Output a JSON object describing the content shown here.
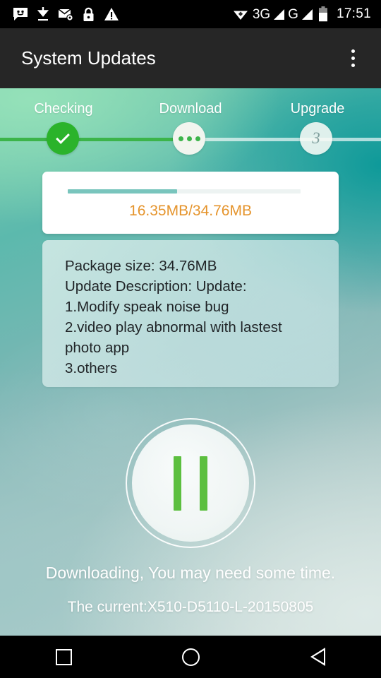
{
  "statusbar": {
    "time": "17:51",
    "left_icons": [
      "message-smiley-icon",
      "download-icon",
      "email-settings-icon",
      "lock-icon",
      "warning-icon"
    ],
    "network_1": "3G",
    "network_2": "G",
    "right_icons": [
      "wifi-diamond-icon",
      "signal-bars-icon",
      "signal-bars-icon",
      "battery-icon"
    ]
  },
  "appbar": {
    "title": "System Updates",
    "overflow_label": "More options"
  },
  "stepper": {
    "steps": [
      {
        "label": "Checking",
        "state": "done",
        "marker": "✓"
      },
      {
        "label": "Download",
        "state": "active",
        "marker": "•••"
      },
      {
        "label": "Upgrade",
        "state": "pending",
        "marker": "3"
      }
    ]
  },
  "progress": {
    "text": "16.35MB/34.76MB",
    "downloaded_mb": 16.35,
    "total_mb": 34.76,
    "percent": 47,
    "fill_color": "#79c5bd",
    "text_color": "#e5942c"
  },
  "description": {
    "lines": [
      "Package size: 34.76MB",
      "Update Description: Update:",
      "1.Modify speak noise bug",
      "2.video play abnormal with lastest",
      "photo app",
      "3.others"
    ]
  },
  "action": {
    "button_name": "pause-download-button",
    "icon": "pause-icon",
    "icon_color": "#5cbf3f"
  },
  "status": {
    "line1": "Downloading, You may need some time.",
    "line2": "The current:X510-D5110-L-20150805"
  },
  "navbar": {
    "recents": "recents-square",
    "home": "home-circle",
    "back": "back-triangle"
  },
  "colors": {
    "appbar_bg": "#262626",
    "accent_green": "#3cb44a",
    "teal": "#79c5bd",
    "orange": "#e5942c"
  }
}
